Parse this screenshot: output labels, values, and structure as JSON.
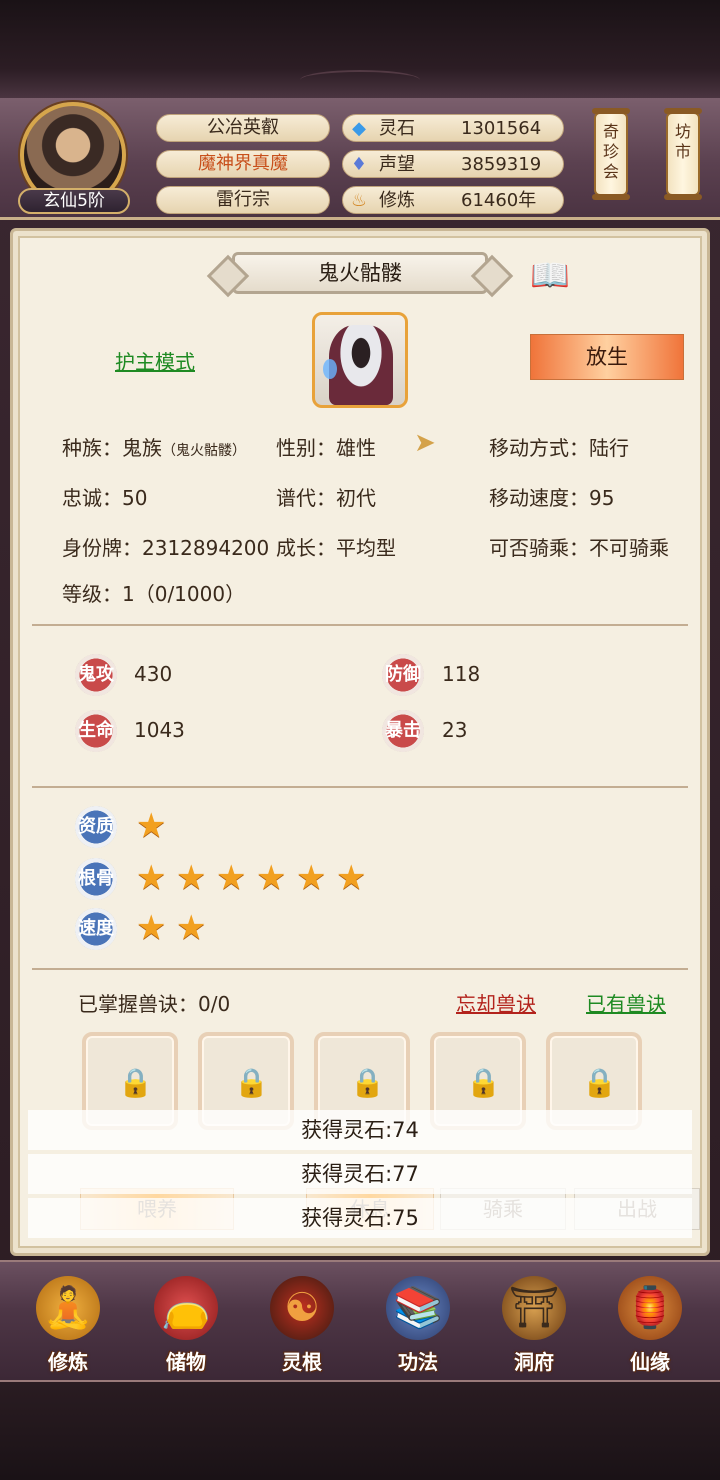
{
  "header": {
    "rank": "玄仙5阶",
    "titles": [
      "公冶英叡",
      "魔神界真魔",
      "雷行宗"
    ],
    "resources": [
      {
        "icon": "spirit-stone-icon",
        "label": "灵石",
        "value": "1301564"
      },
      {
        "icon": "reputation-icon",
        "label": "声望",
        "value": "3859319"
      },
      {
        "icon": "cultivation-icon",
        "label": "修炼",
        "value": "61460年"
      }
    ],
    "scrolls": [
      "奇珍会",
      "坊市"
    ]
  },
  "pet": {
    "name": "鬼火骷髅",
    "mode_link": "护主模式",
    "release_button": "放生",
    "info": {
      "race": "种族：鬼族",
      "race_sub": "（鬼火骷髅）",
      "gender": "性别：雄性",
      "move_mode": "移动方式：陆行",
      "loyalty": "忠诚：50",
      "generation": "谱代：初代",
      "move_speed": "移动速度：95",
      "id_tag": "身份牌：2312894200",
      "growth": "成长：平均型",
      "rideable": "可否骑乘：不可骑乘",
      "level": "等级：1（0/1000）"
    },
    "stats": [
      {
        "badge": "鬼攻",
        "value": "430"
      },
      {
        "badge": "防御",
        "value": "118"
      },
      {
        "badge": "生命",
        "value": "1043"
      },
      {
        "badge": "暴击",
        "value": "23"
      }
    ],
    "ratings": [
      {
        "label": "资质",
        "stars": 1
      },
      {
        "label": "根骨",
        "stars": 6
      },
      {
        "label": "速度",
        "stars": 2
      }
    ],
    "skills_label": "已掌握兽诀：0/0",
    "forget_link": "忘却兽诀",
    "owned_link": "已有兽诀",
    "slots": 5
  },
  "actions": [
    "喂养",
    "休息",
    "骑乘",
    "出战"
  ],
  "toasts": [
    "获得灵石:74",
    "获得灵石:77",
    "获得灵石:75"
  ],
  "nav": [
    "修炼",
    "储物",
    "灵根",
    "功法",
    "洞府",
    "仙缘"
  ],
  "colors": {
    "accent": "#e8a23a",
    "link_green": "#1e8a22",
    "link_red": "#b3231c",
    "star": "#f2a020"
  }
}
